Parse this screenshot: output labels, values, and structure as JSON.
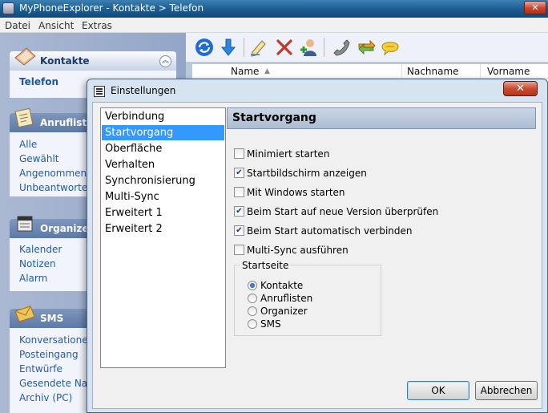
{
  "window": {
    "title": "MyPhoneExplorer -  Kontakte > Telefon",
    "close_glyph": "✕"
  },
  "menu": [
    "Datei",
    "Ansicht",
    "Extras"
  ],
  "sidebar": {
    "groups": [
      {
        "title": "Kontakte",
        "icon": "contacts-book-icon",
        "items": [
          "Telefon"
        ],
        "selected": "Telefon"
      },
      {
        "title": "Anrufliste",
        "icon": "call-list-icon",
        "items": [
          "Alle",
          "Gewählt",
          "Angenommen",
          "Unbeantwortet"
        ]
      },
      {
        "title": "Organizer",
        "icon": "organizer-icon",
        "items": [
          "Kalender",
          "Notizen",
          "Alarm"
        ]
      },
      {
        "title": "SMS",
        "icon": "sms-envelope-icon",
        "items": [
          "Konversationen",
          "Posteingang",
          "Entwürfe",
          "Gesendete Nach",
          "Archiv (PC)"
        ]
      }
    ],
    "collapse_glyph": "︽"
  },
  "toolbar": {
    "icons": [
      "refresh-icon",
      "download-arrow-icon",
      "edit-pencil-icon",
      "delete-x-icon",
      "add-contact-icon",
      "phone-call-icon",
      "sync-arrows-icon",
      "chat-bubble-icon"
    ],
    "colors": {
      "refresh": "#1e6bd6",
      "download": "#2a86e0",
      "delete": "#c0392b",
      "call": "#666666",
      "sync": "#d88a1a",
      "chat": "#e6b820"
    }
  },
  "list": {
    "columns": [
      "Name",
      "Nachname",
      "Vorname"
    ],
    "sort_glyph": "▲"
  },
  "dialog": {
    "title": "Einstellungen",
    "close_glyph": "✕",
    "nav_items": [
      "Verbindung",
      "Startvorgang",
      "Oberfläche",
      "Verhalten",
      "Synchronisierung",
      "Multi-Sync",
      "Erweitert 1",
      "Erweitert 2"
    ],
    "nav_selected_index": 1,
    "panel_title": "Startvorgang",
    "checkboxes": [
      {
        "label": "Minimiert starten",
        "checked": false
      },
      {
        "label": "Startbildschirm anzeigen",
        "checked": true
      },
      {
        "label": "Mit Windows starten",
        "checked": false
      },
      {
        "label": "Beim Start auf neue Version überprüfen",
        "checked": true
      },
      {
        "label": "Beim Start automatisch verbinden",
        "checked": true
      },
      {
        "label": "Multi-Sync ausführen",
        "checked": false
      }
    ],
    "startseite": {
      "legend": "Startseite",
      "options": [
        "Kontakte",
        "Anruflisten",
        "Organizer",
        "SMS"
      ],
      "selected": "Kontakte"
    },
    "ok_label": "OK",
    "cancel_label": "Abbrechen"
  }
}
